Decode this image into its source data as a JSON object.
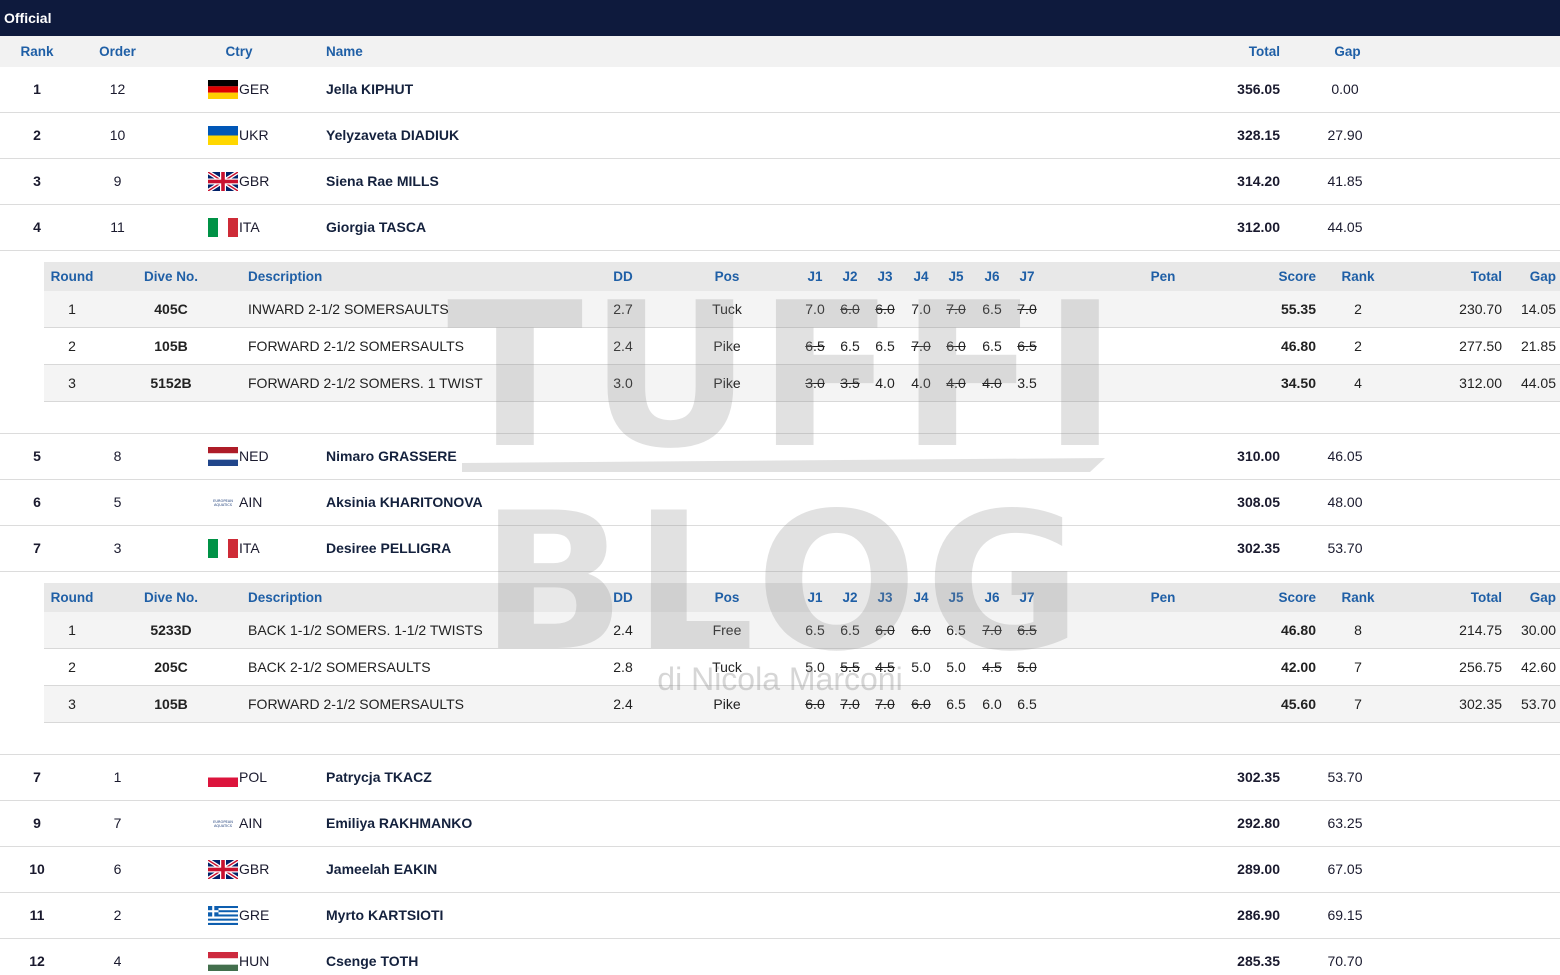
{
  "topbar": {
    "title": "Official"
  },
  "header": {
    "rank": "Rank",
    "order": "Order",
    "ctry": "Ctry",
    "name": "Name",
    "total": "Total",
    "gap": "Gap"
  },
  "dive_header": {
    "round": "Round",
    "dive_no": "Dive No.",
    "description": "Description",
    "dd": "DD",
    "pos": "Pos",
    "j1": "J1",
    "j2": "J2",
    "j3": "J3",
    "j4": "J4",
    "j5": "J5",
    "j6": "J6",
    "j7": "J7",
    "pen": "Pen",
    "score": "Score",
    "rank": "Rank",
    "total": "Total",
    "gap": "Gap"
  },
  "watermark": {
    "line1": "TUFFI",
    "line2": "BLOG",
    "credit": "di Nicola Marconi"
  },
  "ain_flag_text": "EUROPEAN AQUATICS",
  "athletes": [
    {
      "rank": "1",
      "order": "12",
      "flag": "GER",
      "ctry": "GER",
      "name": "Jella KIPHUT",
      "total": "356.05",
      "gap": "0.00"
    },
    {
      "rank": "2",
      "order": "10",
      "flag": "UKR",
      "ctry": "UKR",
      "name": "Yelyzaveta DIADIUK",
      "total": "328.15",
      "gap": "27.90"
    },
    {
      "rank": "3",
      "order": "9",
      "flag": "GBR",
      "ctry": "GBR",
      "name": "Siena Rae MILLS",
      "total": "314.20",
      "gap": "41.85"
    },
    {
      "rank": "4",
      "order": "11",
      "flag": "ITA",
      "ctry": "ITA",
      "name": "Giorgia TASCA",
      "total": "312.00",
      "gap": "44.05",
      "dives": [
        {
          "round": "1",
          "dive_no": "405C",
          "description": "INWARD 2-1/2 SOMERSAULTS",
          "dd": "2.7",
          "pos": "Tuck",
          "judges": [
            "7.0",
            "6.0",
            "6.0",
            "7.0",
            "7.0",
            "6.5",
            "7.0"
          ],
          "struck": [
            false,
            true,
            true,
            false,
            true,
            false,
            true
          ],
          "pen": "",
          "score": "55.35",
          "rank": "2",
          "total": "230.70",
          "gap": "14.05"
        },
        {
          "round": "2",
          "dive_no": "105B",
          "description": "FORWARD 2-1/2 SOMERSAULTS",
          "dd": "2.4",
          "pos": "Pike",
          "judges": [
            "6.5",
            "6.5",
            "6.5",
            "7.0",
            "6.0",
            "6.5",
            "6.5"
          ],
          "struck": [
            true,
            false,
            false,
            true,
            true,
            false,
            true
          ],
          "pen": "",
          "score": "46.80",
          "rank": "2",
          "total": "277.50",
          "gap": "21.85"
        },
        {
          "round": "3",
          "dive_no": "5152B",
          "description": "FORWARD 2-1/2 SOMERS. 1 TWIST",
          "dd": "3.0",
          "pos": "Pike",
          "judges": [
            "3.0",
            "3.5",
            "4.0",
            "4.0",
            "4.0",
            "4.0",
            "3.5"
          ],
          "struck": [
            true,
            true,
            false,
            false,
            true,
            true,
            false
          ],
          "pen": "",
          "score": "34.50",
          "rank": "4",
          "total": "312.00",
          "gap": "44.05"
        }
      ]
    },
    {
      "rank": "5",
      "order": "8",
      "flag": "NED",
      "ctry": "NED",
      "name": "Nimaro GRASSERE",
      "total": "310.00",
      "gap": "46.05"
    },
    {
      "rank": "6",
      "order": "5",
      "flag": "AIN",
      "ctry": "AIN",
      "name": "Aksinia KHARITONOVA",
      "total": "308.05",
      "gap": "48.00"
    },
    {
      "rank": "7",
      "order": "3",
      "flag": "ITA",
      "ctry": "ITA",
      "name": "Desiree PELLIGRA",
      "total": "302.35",
      "gap": "53.70",
      "dives": [
        {
          "round": "1",
          "dive_no": "5233D",
          "description": "BACK 1-1/2 SOMERS. 1-1/2 TWISTS",
          "dd": "2.4",
          "pos": "Free",
          "judges": [
            "6.5",
            "6.5",
            "6.0",
            "6.0",
            "6.5",
            "7.0",
            "6.5"
          ],
          "struck": [
            false,
            false,
            true,
            true,
            false,
            true,
            true
          ],
          "pen": "",
          "score": "46.80",
          "rank": "8",
          "total": "214.75",
          "gap": "30.00"
        },
        {
          "round": "2",
          "dive_no": "205C",
          "description": "BACK 2-1/2 SOMERSAULTS",
          "dd": "2.8",
          "pos": "Tuck",
          "judges": [
            "5.0",
            "5.5",
            "4.5",
            "5.0",
            "5.0",
            "4.5",
            "5.0"
          ],
          "struck": [
            false,
            true,
            true,
            false,
            false,
            true,
            true
          ],
          "pen": "",
          "score": "42.00",
          "rank": "7",
          "total": "256.75",
          "gap": "42.60"
        },
        {
          "round": "3",
          "dive_no": "105B",
          "description": "FORWARD 2-1/2 SOMERSAULTS",
          "dd": "2.4",
          "pos": "Pike",
          "judges": [
            "6.0",
            "7.0",
            "7.0",
            "6.0",
            "6.5",
            "6.0",
            "6.5"
          ],
          "struck": [
            true,
            true,
            true,
            true,
            false,
            false,
            false
          ],
          "pen": "",
          "score": "45.60",
          "rank": "7",
          "total": "302.35",
          "gap": "53.70"
        }
      ]
    },
    {
      "rank": "7",
      "order": "1",
      "flag": "POL",
      "ctry": "POL",
      "name": "Patrycja TKACZ",
      "total": "302.35",
      "gap": "53.70"
    },
    {
      "rank": "9",
      "order": "7",
      "flag": "AIN",
      "ctry": "AIN",
      "name": "Emiliya RAKHMANKO",
      "total": "292.80",
      "gap": "63.25"
    },
    {
      "rank": "10",
      "order": "6",
      "flag": "GBR",
      "ctry": "GBR",
      "name": "Jameelah EAKIN",
      "total": "289.00",
      "gap": "67.05"
    },
    {
      "rank": "11",
      "order": "2",
      "flag": "GRE",
      "ctry": "GRE",
      "name": "Myrto KARTSIOTI",
      "total": "286.90",
      "gap": "69.15"
    },
    {
      "rank": "12",
      "order": "4",
      "flag": "HUN",
      "ctry": "HUN",
      "name": "Csenge TOTH",
      "total": "285.35",
      "gap": "70.70"
    }
  ]
}
